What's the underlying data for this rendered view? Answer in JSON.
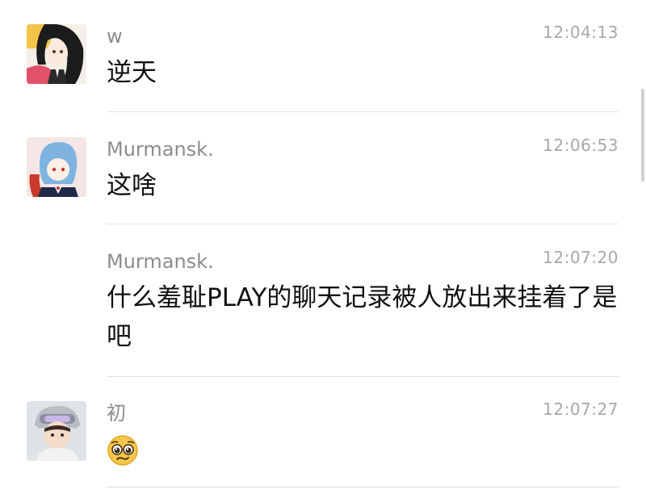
{
  "messages": [
    {
      "sender": "w",
      "time": "12:04:13",
      "text": "逆天",
      "avatar_icon": "anime-girl-black-hair-avatar"
    },
    {
      "sender": "Murmansk.",
      "time": "12:06:53",
      "text": "这啥",
      "avatar_icon": "anime-girl-blue-hair-avatar"
    },
    {
      "sender": "Murmansk.",
      "time": "12:07:20",
      "text": "什么羞耻PLAY的聊天记录被人放出来挂着了是吧"
    },
    {
      "sender": "初",
      "time": "12:07:27",
      "emoji": "pleading-face-emoji",
      "avatar_icon": "anime-boy-with-goggles-avatar"
    }
  ],
  "colors": {
    "background": "#ffffff",
    "sender_text": "#8c8c8c",
    "time_text": "#a8a8a8",
    "message_text": "#111111",
    "divider": "#e1e1e1"
  }
}
